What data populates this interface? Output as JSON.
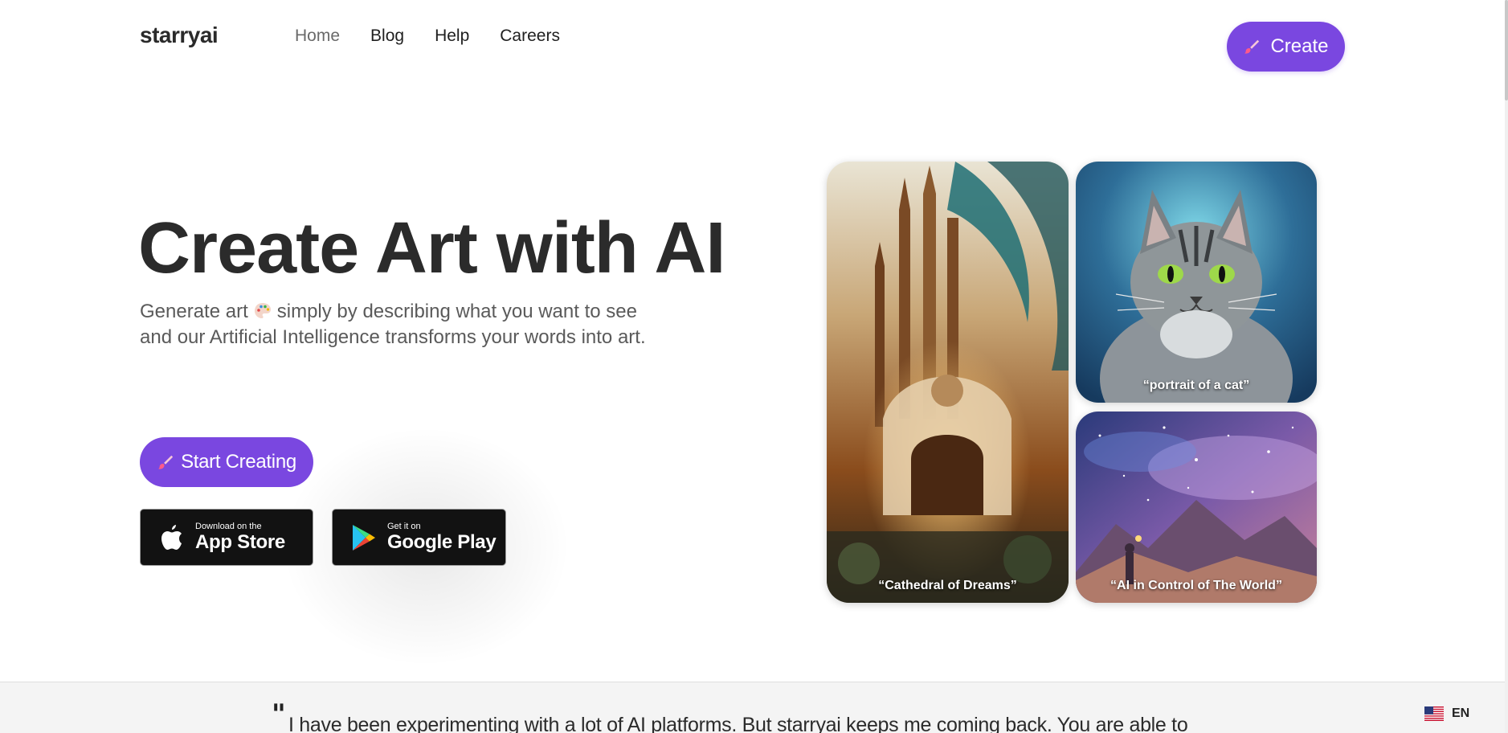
{
  "header": {
    "logo": "starryai",
    "nav": [
      "Home",
      "Blog",
      "Help",
      "Careers"
    ],
    "create_label": "Create"
  },
  "hero": {
    "title": "Create Art with AI",
    "subtitle_part1": "Generate art",
    "subtitle_part2": "simply by describing what you want to see and our Artificial Intelligence transforms your words into art.",
    "start_label": "Start Creating"
  },
  "stores": {
    "apple_small": "Download on the",
    "apple_big": "App Store",
    "google_small": "Get it on",
    "google_big": "Google Play"
  },
  "gallery": {
    "cathedral": "“Cathedral of Dreams”",
    "cat": "“portrait of a cat”",
    "space": "“AI in Control of The World”"
  },
  "testimonial": {
    "quote_mark": "\"",
    "text": "I have been experimenting with a lot of AI platforms. But starryai keeps me coming back. You are able to"
  },
  "language": "EN",
  "colors": {
    "accent": "#7a47e0",
    "store_bg": "#121212",
    "band_bg": "#f4f4f4"
  }
}
